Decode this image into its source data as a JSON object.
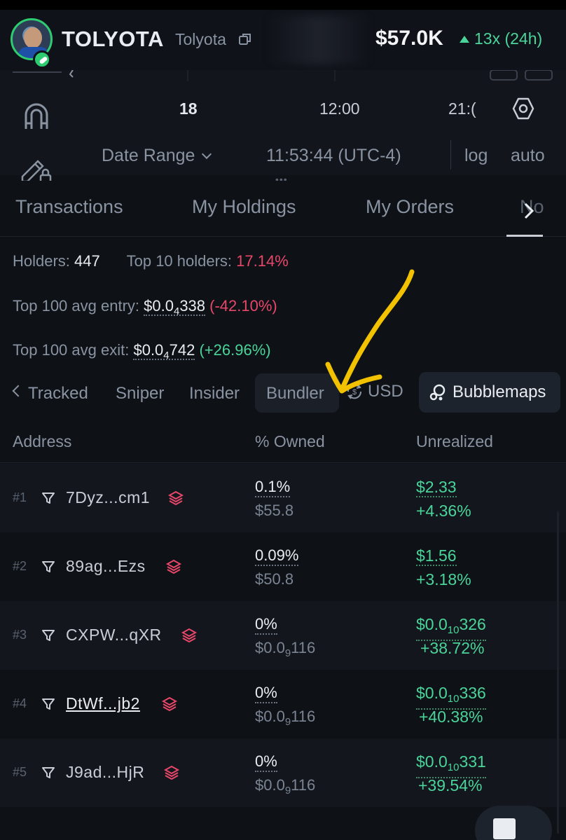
{
  "header": {
    "token_symbol": "TOLYOTA",
    "token_name": "Tolyota",
    "market_cap": "$57.0K",
    "change": "13x (24h)"
  },
  "chart": {
    "time_labels": [
      "18",
      "12:00",
      "21:("
    ],
    "date_range_label": "Date Range",
    "clock": "11:53:44 (UTC-4)",
    "log_label": "log",
    "auto_label": "auto",
    "drag_handle": "•••"
  },
  "tabs": {
    "items": [
      "Transactions",
      "My Holdings",
      "My Orders",
      "No"
    ]
  },
  "stats": {
    "holders_label": "Holders:",
    "holders_value": "447",
    "top10_label": "Top 10 holders:",
    "top10_value": "17.14%",
    "entry_label": "Top 100 avg entry:",
    "entry_prefix": "$0.0",
    "entry_sub": "4",
    "entry_suffix": "338",
    "entry_change": "(-42.10%)",
    "exit_label": "Top 100 avg exit:",
    "exit_prefix": "$0.0",
    "exit_sub": "4",
    "exit_suffix": "742",
    "exit_change": "(+26.96%)"
  },
  "filters": {
    "tracked": "Tracked",
    "sniper": "Sniper",
    "insider": "Insider",
    "bundler": "Bundler",
    "currency": "USD",
    "bubblemaps": "Bubblemaps"
  },
  "table": {
    "headers": [
      "Address",
      "% Owned",
      "Unrealized"
    ],
    "rows": [
      {
        "rank": "#1",
        "address": "7Dyz...cm1",
        "owned_pct": "0.1%",
        "owned_usd": "$55.8",
        "unreal_usd": "$2.33",
        "unreal_pct": "+4.36%"
      },
      {
        "rank": "#2",
        "address": "89ag...Ezs",
        "owned_pct": "0.09%",
        "owned_usd": "$50.8",
        "unreal_usd": "$1.56",
        "unreal_pct": "+3.18%"
      },
      {
        "rank": "#3",
        "address": "CXPW...qXR",
        "owned_pct": "0%",
        "owned_usd_prefix": "$0.0",
        "owned_usd_sub": "9",
        "owned_usd_suffix": "116",
        "unreal_prefix": "$0.0",
        "unreal_sub": "10",
        "unreal_suffix": "326",
        "unreal_pct": "+38.72%"
      },
      {
        "rank": "#4",
        "address": "DtWf...jb2",
        "owned_pct": "0%",
        "owned_usd_prefix": "$0.0",
        "owned_usd_sub": "9",
        "owned_usd_suffix": "116",
        "unreal_prefix": "$0.0",
        "unreal_sub": "10",
        "unreal_suffix": "336",
        "unreal_pct": "+40.38%"
      },
      {
        "rank": "#5",
        "address": "J9ad...HjR",
        "owned_pct": "0%",
        "owned_usd_prefix": "$0.0",
        "owned_usd_sub": "9",
        "owned_usd_suffix": "116",
        "unreal_prefix": "$0.0",
        "unreal_sub": "10",
        "unreal_suffix": "331",
        "unreal_pct": "+39.54%"
      }
    ]
  },
  "colors": {
    "positive": "#4ad49a",
    "negative": "#e8476a",
    "annotation": "#f2c200",
    "verified": "#2ecc71",
    "bundler_icon": "#e8476a"
  },
  "icons": [
    "copy-icon",
    "magnet-icon",
    "pencil-lock-icon",
    "settings-icon",
    "chevron-down-icon",
    "chevron-right-icon",
    "chevron-left-icon",
    "swap-currency-icon",
    "bubblemaps-icon",
    "filter-icon",
    "layers-icon",
    "pill-icon"
  ]
}
